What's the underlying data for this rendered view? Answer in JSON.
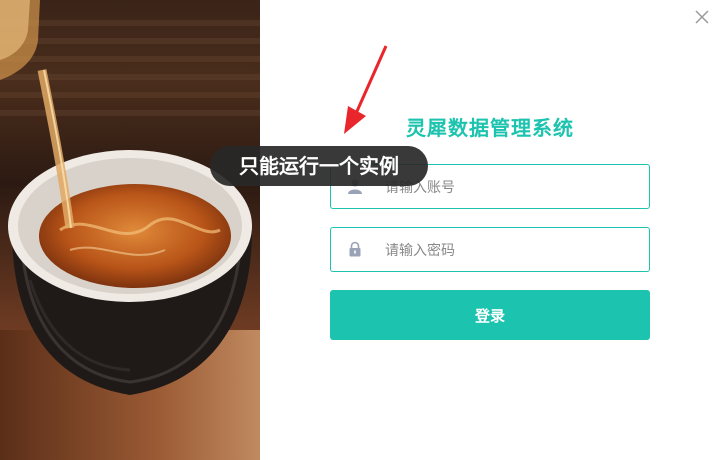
{
  "window": {
    "close_icon": "close-icon"
  },
  "app": {
    "title": "灵犀数据管理系统"
  },
  "login_form": {
    "account_placeholder": "请输入账号",
    "account_icon": "user-icon",
    "password_placeholder": "请输入密码",
    "password_icon": "lock-icon",
    "login_label": "登录"
  },
  "toast": {
    "message": "只能运行一个实例"
  },
  "colors": {
    "accent": "#1cc3ae",
    "toast_bg": "#2b2b2b",
    "annotation_arrow": "#e8262b"
  }
}
